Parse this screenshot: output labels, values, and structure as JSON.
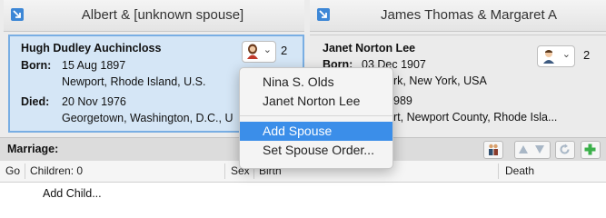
{
  "parents": {
    "left_title": "Albert & [unknown spouse]",
    "right_title": "James Thomas & Margaret A"
  },
  "person_left": {
    "name": "Hugh Dudley Auchincloss",
    "born_label": "Born:",
    "born_date": "15 Aug 1897",
    "born_place": "Newport, Rhode Island, U.S.",
    "died_label": "Died:",
    "died_date": "20 Nov 1976",
    "died_place": "Georgetown, Washington, D.C., U",
    "spouse_count": "2"
  },
  "person_right": {
    "name": "Janet Norton Lee",
    "born_label": "Born:",
    "born_date": "03 Dec 1907",
    "born_place": "rk, New York, USA",
    "died_date": "989",
    "died_place": "rt, Newport County, Rhode Isla...",
    "spouse_count": "2"
  },
  "context_menu": {
    "spouses": [
      "Nina S. Olds",
      "Janet Norton Lee"
    ],
    "add_spouse": "Add Spouse",
    "set_order": "Set Spouse Order..."
  },
  "marriage": {
    "label": "Marriage:"
  },
  "children_table": {
    "columns": [
      "Go",
      "Children: 0",
      "Sex",
      "Birth",
      "Death"
    ],
    "add_child": "Add Child..."
  },
  "colors": {
    "accent": "#3b8ee9",
    "selected_card": "#d5e6f6",
    "card_border": "#79aee3"
  }
}
